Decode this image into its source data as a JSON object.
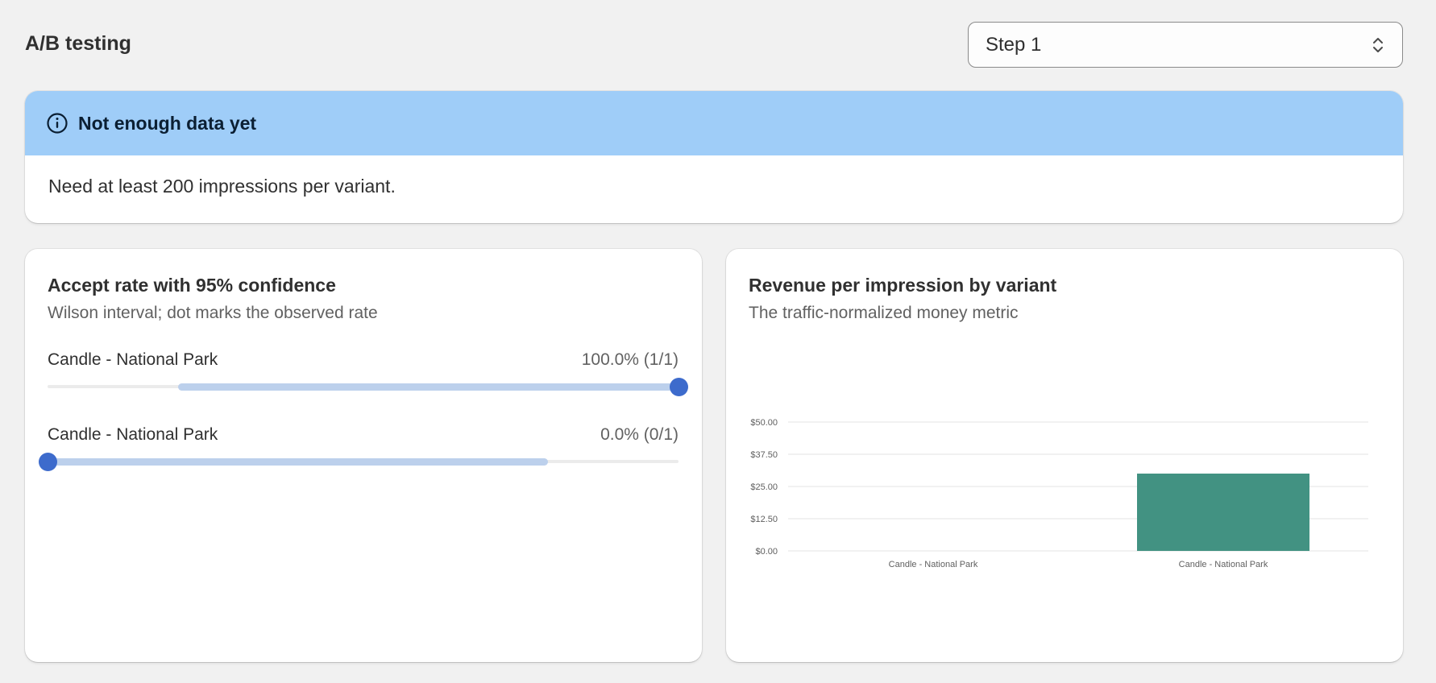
{
  "header": {
    "title": "A/B testing",
    "step_select": {
      "value": "Step 1"
    }
  },
  "banner": {
    "title": "Not enough data yet",
    "message": "Need at least 200 impressions per variant.",
    "color": "#9fcdf8"
  },
  "accept_card": {
    "title": "Accept rate with 95% confidence",
    "subtitle": "Wilson interval; dot marks the observed rate",
    "variants": [
      {
        "name": "Candle - National Park",
        "rate_label": "100.0% (1/1)",
        "observed": 1.0,
        "ci_low": 0.207,
        "ci_high": 1.0
      },
      {
        "name": "Candle - National Park",
        "rate_label": "0.0% (0/1)",
        "observed": 0.0,
        "ci_low": 0.0,
        "ci_high": 0.793
      }
    ],
    "dot_color": "#3d6bcc",
    "interval_color": "#bcd0ec"
  },
  "revenue_card": {
    "title": "Revenue per impression by variant",
    "subtitle": "The traffic-normalized money metric"
  },
  "chart_data": {
    "type": "bar",
    "categories": [
      "Candle - National Park",
      "Candle - National Park"
    ],
    "values": [
      0,
      30
    ],
    "ylim": [
      0,
      50
    ],
    "yticks": [
      "$0.00",
      "$12.50",
      "$25.00",
      "$37.50",
      "$50.00"
    ],
    "ytick_values": [
      0,
      12.5,
      25,
      37.5,
      50
    ],
    "grid": true,
    "bar_color": "#429282"
  }
}
